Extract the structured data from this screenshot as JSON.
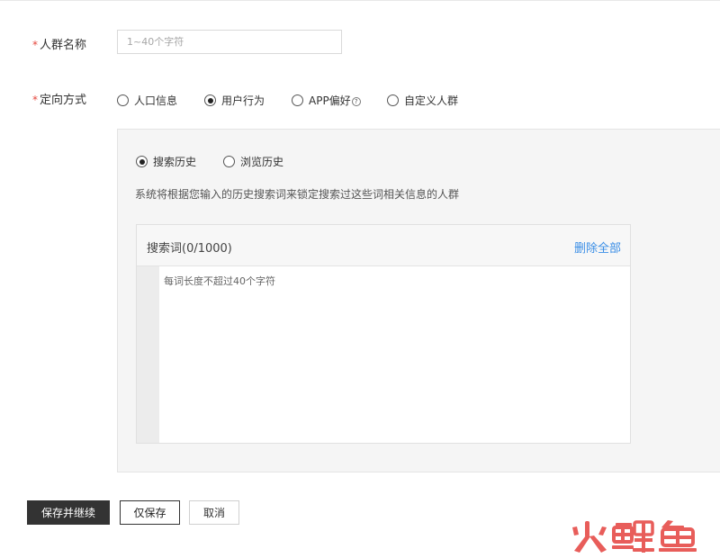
{
  "form": {
    "name": {
      "required_mark": "*",
      "label": "人群名称",
      "placeholder": "1~40个字符",
      "value": ""
    },
    "targeting": {
      "required_mark": "*",
      "label": "定向方式",
      "options": [
        {
          "label": "人口信息",
          "selected": false
        },
        {
          "label": "用户行为",
          "selected": true
        },
        {
          "label": "APP偏好",
          "selected": false,
          "has_help_icon": true
        },
        {
          "label": "自定义人群",
          "selected": false
        }
      ],
      "help_glyph": "?"
    }
  },
  "behavior_panel": {
    "history_options": [
      {
        "label": "搜索历史",
        "selected": true
      },
      {
        "label": "浏览历史",
        "selected": false
      }
    ],
    "description": "系统将根据您输入的历史搜索词来锁定搜索过这些词相关信息的人群",
    "keywords": {
      "title": "搜索词(0/1000)",
      "delete_all_label": "删除全部",
      "placeholder": "每词长度不超过40个字符",
      "value": ""
    }
  },
  "actions": {
    "save_continue_label": "保存并继续",
    "save_only_label": "仅保存",
    "cancel_label": "取消"
  },
  "watermark": {
    "text": "火鲤鱼"
  },
  "colors": {
    "required": "#e5473e",
    "link": "#3a8ee6",
    "primary_button": "#333333",
    "panel_bg": "#f5f5f5"
  }
}
